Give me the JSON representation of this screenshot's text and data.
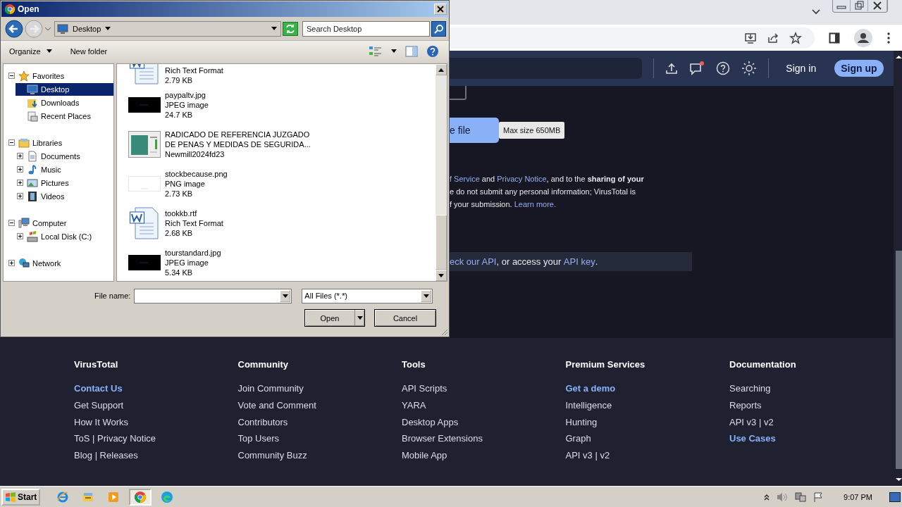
{
  "browser": {
    "header": {
      "sign_in": "Sign in",
      "sign_up": "Sign up",
      "notification": true
    },
    "upload": {
      "button": "e file",
      "tooltip": "Max size 650MB"
    },
    "terms_lines": [
      [
        {
          "t": "f Service",
          "kind": "link"
        },
        {
          "t": " and ",
          "kind": "text"
        },
        {
          "t": "Privacy Notice",
          "kind": "link"
        },
        {
          "t": ", and to the **sharing of your**",
          "kind": "text"
        }
      ],
      [
        {
          "t": "e do not submit any personal information; VirusTotal is",
          "kind": "text"
        }
      ],
      [
        {
          "t": "f your submission. ",
          "kind": "text"
        },
        {
          "t": "Learn more.",
          "kind": "link"
        }
      ]
    ],
    "api_banner": [
      {
        "t": "eck our API",
        "kind": "link"
      },
      {
        "t": ", or access your ",
        "kind": "text"
      },
      {
        "t": "API key",
        "kind": "link"
      },
      {
        "t": ".",
        "kind": "text"
      }
    ],
    "footer": [
      {
        "title": "VirusTotal",
        "links": [
          {
            "label": "Contact Us",
            "kind": "highlight"
          },
          {
            "label": "Get Support",
            "kind": "normal"
          },
          {
            "label": "How It Works",
            "kind": "normal"
          },
          {
            "label": "ToS | Privacy Notice",
            "kind": "normal"
          },
          {
            "label": "Blog | Releases",
            "kind": "normal"
          }
        ]
      },
      {
        "title": "Community",
        "links": [
          {
            "label": "Join Community",
            "kind": "normal"
          },
          {
            "label": "Vote and Comment",
            "kind": "normal"
          },
          {
            "label": "Contributors",
            "kind": "normal"
          },
          {
            "label": "Top Users",
            "kind": "normal"
          },
          {
            "label": "Community Buzz",
            "kind": "normal"
          }
        ]
      },
      {
        "title": "Tools",
        "links": [
          {
            "label": "API Scripts",
            "kind": "normal"
          },
          {
            "label": "YARA",
            "kind": "normal"
          },
          {
            "label": "Desktop Apps",
            "kind": "normal"
          },
          {
            "label": "Browser Extensions",
            "kind": "normal"
          },
          {
            "label": "Mobile App",
            "kind": "normal"
          }
        ]
      },
      {
        "title": "Premium Services",
        "links": [
          {
            "label": "Get a demo",
            "kind": "highlight"
          },
          {
            "label": "Intelligence",
            "kind": "normal"
          },
          {
            "label": "Hunting",
            "kind": "normal"
          },
          {
            "label": "Graph",
            "kind": "normal"
          },
          {
            "label": "API v3 | v2",
            "kind": "normal"
          }
        ]
      },
      {
        "title": "Documentation",
        "links": [
          {
            "label": "Searching",
            "kind": "normal"
          },
          {
            "label": "Reports",
            "kind": "normal"
          },
          {
            "label": "API v3 | v2",
            "kind": "normal"
          },
          {
            "label": "Use Cases",
            "kind": "highlight"
          }
        ]
      }
    ]
  },
  "dialog": {
    "title": "Open",
    "location": "Desktop",
    "search": {
      "placeholder": "Search Desktop"
    },
    "toolbar": [
      {
        "label": "Organize",
        "menu": true
      },
      {
        "label": "New folder",
        "menu": false
      }
    ],
    "tree": [
      {
        "label": "Favorites",
        "expanded": true,
        "selected": false,
        "children": [
          {
            "label": "Desktop",
            "selected": true
          },
          {
            "label": "Downloads",
            "selected": false
          },
          {
            "label": "Recent Places",
            "selected": false
          }
        ]
      },
      {
        "label": "Libraries",
        "expanded": true,
        "selected": false,
        "children": [
          {
            "label": "Documents",
            "expanded": false,
            "selected": false
          },
          {
            "label": "Music",
            "expanded": false,
            "selected": false
          },
          {
            "label": "Pictures",
            "expanded": false,
            "selected": false
          },
          {
            "label": "Videos",
            "expanded": false,
            "selected": false
          }
        ]
      },
      {
        "label": "Computer",
        "expanded": true,
        "selected": false,
        "children": [
          {
            "label": "Local Disk (C:)",
            "expanded": false,
            "selected": false
          }
        ]
      },
      {
        "label": "Network",
        "expanded": false,
        "selected": false
      }
    ],
    "files": [
      {
        "kind": "document",
        "lines": [
          "Rich Text Format",
          "2.79 KB"
        ]
      },
      {
        "kind": "image",
        "lines": [
          "paypaltv.jpg",
          "JPEG image",
          "24.7 KB"
        ]
      },
      {
        "kind": "screenshot",
        "lines": [
          "RADICADO DE REFERENCIA JUZGADO",
          "DE PENAS Y MEDIDAS DE SEGURIDA...",
          "Newmill2024fd23"
        ]
      },
      {
        "kind": "blank-image",
        "lines": [
          "stockbecause.png",
          "PNG image",
          "2.73 KB"
        ]
      },
      {
        "kind": "document",
        "lines": [
          "tookkb.rtf",
          "Rich Text Format",
          "2.68 KB"
        ]
      },
      {
        "kind": "image",
        "lines": [
          "tourstandard.jpg",
          "JPEG image",
          "5.34 KB"
        ]
      }
    ],
    "file_name": {
      "label": "File name:"
    },
    "filter": "All Files (*.*)",
    "buttons": [
      {
        "label": "Open",
        "kind": "split"
      },
      {
        "label": "Cancel",
        "kind": "plain"
      }
    ]
  },
  "taskbar": {
    "start": "Start",
    "apps": [
      {
        "kind": "ie",
        "selected": false
      },
      {
        "kind": "explorer",
        "selected": false
      },
      {
        "kind": "media",
        "selected": false
      },
      {
        "kind": "chrome",
        "selected": true
      },
      {
        "kind": "edge",
        "selected": false
      }
    ],
    "time": "9:07 PM"
  }
}
